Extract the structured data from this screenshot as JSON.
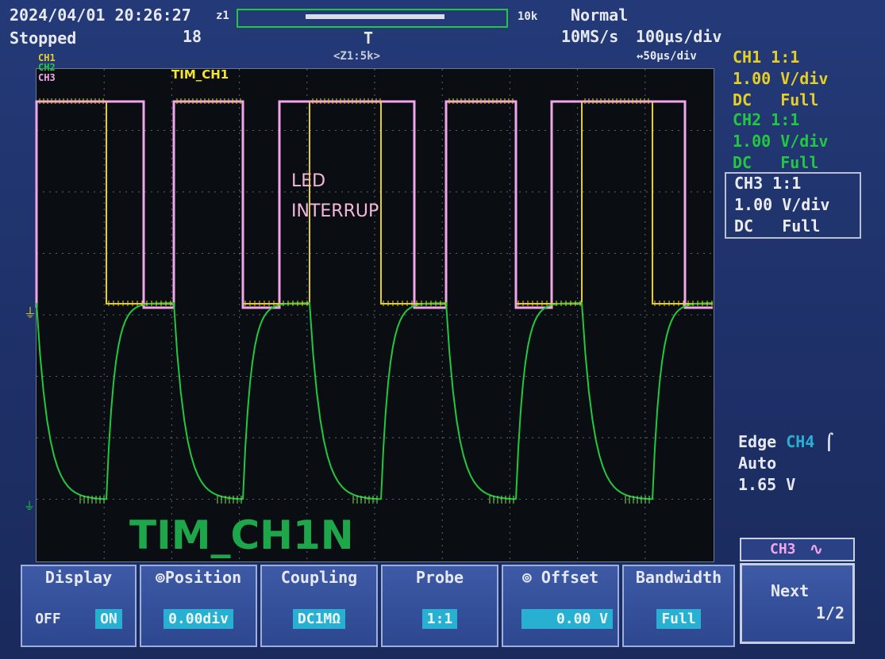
{
  "header": {
    "datetime": "2024/04/01 20:26:27",
    "status": "Stopped",
    "record_count": "18",
    "memory_length": "10k",
    "trigger_mode": "Normal",
    "sample_rate": "10MS/s",
    "timebase": "100µs/div",
    "zoom_label": "<Z1:5k>",
    "zoom_timebase": "↔50µs/div"
  },
  "channels_legend": [
    "CH1",
    "CH2",
    "CH3"
  ],
  "channel_settings": [
    {
      "name": "CH1 1:1",
      "scale": "1.00 V/div",
      "coupling": "DC",
      "bandwidth": "Full",
      "color": "#e6cf24"
    },
    {
      "name": "CH2 1:1",
      "scale": "1.00 V/div",
      "coupling": "DC",
      "bandwidth": "Full",
      "color": "#22c840"
    },
    {
      "name": "CH3 1:1",
      "scale": "1.00 V/div",
      "coupling": "DC",
      "bandwidth": "Full",
      "color": "#ecedf2"
    }
  ],
  "trigger": {
    "type": "Edge",
    "source": "CH4",
    "mode": "Auto",
    "level": "1.65 V"
  },
  "annotations": {
    "tim_ch1": "TIM_CH1",
    "led": "LED",
    "interrup": "INTERRUP",
    "tim_ch1n": "TIM_CH1N"
  },
  "softkeys": {
    "active_channel": "CH3",
    "display": {
      "title": "Display",
      "off": "OFF",
      "on": "ON"
    },
    "position": {
      "title": "Position",
      "value": "0.00div"
    },
    "coupling": {
      "title": "Coupling",
      "value": "DC1MΩ"
    },
    "probe": {
      "title": "Probe",
      "value": "1:1"
    },
    "offset": {
      "title": "Offset",
      "value": "0.00 V"
    },
    "bandwidth": {
      "title": "Bandwidth",
      "value": "Full"
    },
    "next": {
      "title": "Next",
      "page": "1/2"
    }
  },
  "colors": {
    "ch1": "#e6cf24",
    "ch2": "#22c840",
    "ch3": "#f0a6e8",
    "annot_pink": "#f4b8d8",
    "annot_green": "#1ea64a"
  }
}
